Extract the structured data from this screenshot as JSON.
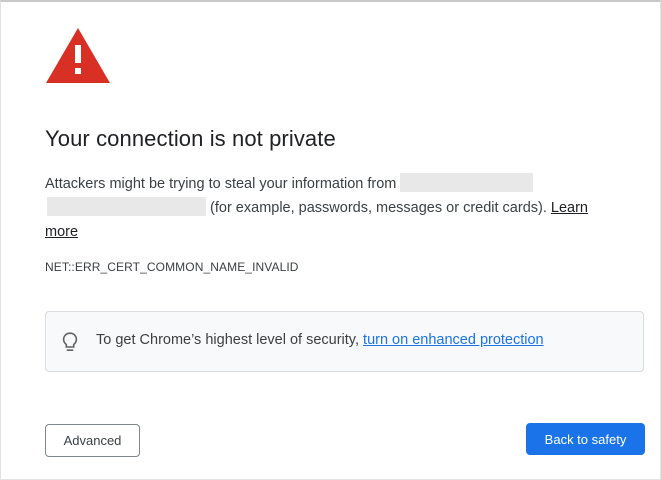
{
  "page": {
    "title": "Your connection is not private",
    "message_before": "Attackers might be trying to steal your information from",
    "message_after": "(for example, passwords, messages or credit cards).",
    "learn_more_label": "Learn more",
    "error_code": "NET::ERR_CERT_COMMON_NAME_INVALID"
  },
  "security_tip": {
    "text": "To get Chrome’s highest level of security,",
    "link_label": "turn on enhanced protection",
    "icon": "lightbulb-icon"
  },
  "buttons": {
    "advanced_label": "Advanced",
    "back_to_safety_label": "Back to safety"
  },
  "icons": {
    "warning": "warning-triangle-icon"
  },
  "colors": {
    "warning_red": "#d93025",
    "primary_blue": "#1a73e8",
    "text": "#202124",
    "redaction_gray": "#e8e8e8"
  }
}
